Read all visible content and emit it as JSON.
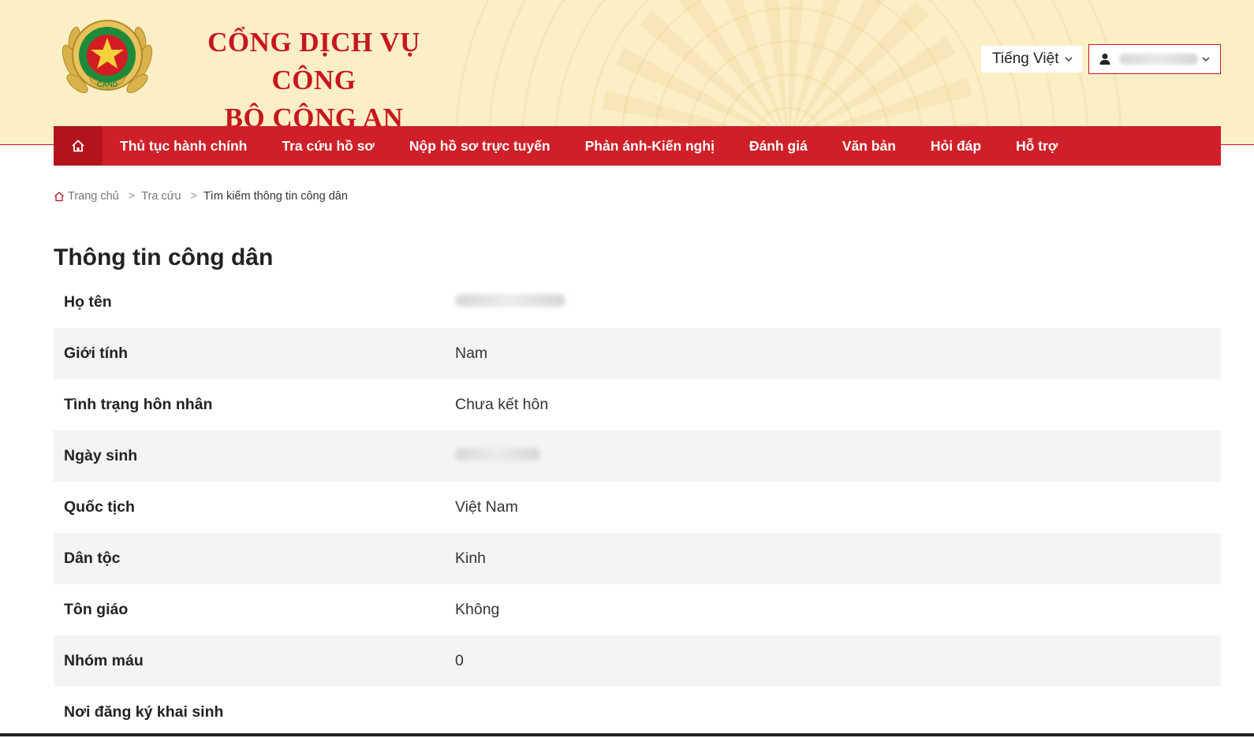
{
  "header": {
    "title_line1": "CỔNG DỊCH VỤ CÔNG",
    "title_line2": "BỘ CÔNG AN",
    "language": "Tiếng Việt",
    "user_name": ""
  },
  "nav": {
    "items": [
      {
        "label": "Thủ tục hành chính"
      },
      {
        "label": "Tra cứu hồ sơ"
      },
      {
        "label": "Nộp hồ sơ trực tuyến"
      },
      {
        "label": "Phản ánh-Kiến nghị"
      },
      {
        "label": "Đánh giá"
      },
      {
        "label": "Văn bản"
      },
      {
        "label": "Hỏi đáp"
      },
      {
        "label": "Hỗ trợ"
      }
    ]
  },
  "breadcrumb": {
    "home": "Trang chủ",
    "level1": "Tra cứu",
    "current": "Tìm kiếm thông tin công dân",
    "separator": ">"
  },
  "main": {
    "title": "Thông tin công dân",
    "rows": [
      {
        "label": "Họ tên",
        "value": ""
      },
      {
        "label": "Giới tính",
        "value": "Nam"
      },
      {
        "label": "Tình trạng hôn nhân",
        "value": "Chưa kết hôn"
      },
      {
        "label": "Ngày sinh",
        "value": ""
      },
      {
        "label": "Quốc tịch",
        "value": "Việt Nam"
      },
      {
        "label": "Dân tộc",
        "value": "Kinh"
      },
      {
        "label": "Tôn giáo",
        "value": "Không"
      },
      {
        "label": "Nhóm máu",
        "value": "0"
      },
      {
        "label": "Nơi đăng ký khai sinh",
        "value": ""
      }
    ]
  },
  "colors": {
    "brand_red": "#c8161d",
    "nav_red": "#d01f28",
    "header_bg": "#fcefc6",
    "row_shade": "#f3f4f6"
  },
  "icons": {
    "home": "home-icon",
    "user": "user-icon",
    "dropdown": "chevron-down-icon",
    "emblem": "police-emblem-logo"
  }
}
